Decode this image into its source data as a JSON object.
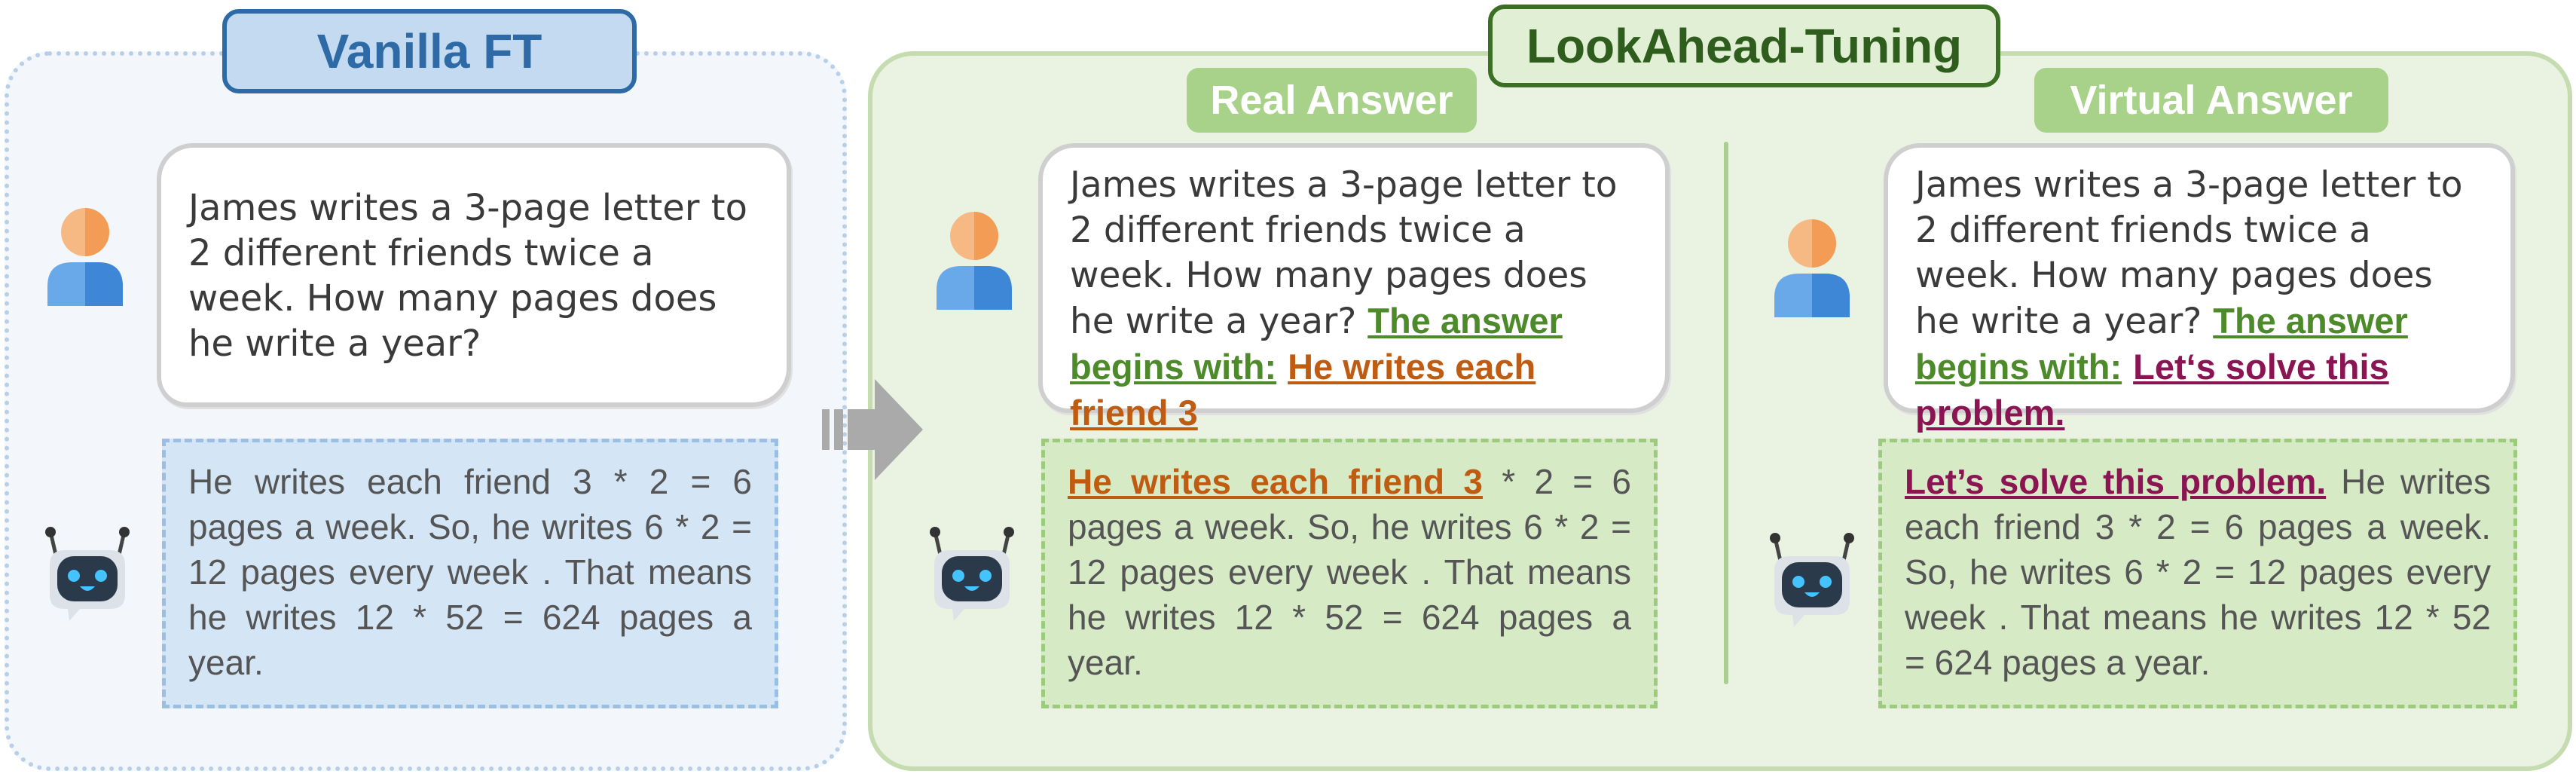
{
  "vanilla": {
    "title": "Vanilla FT",
    "question": "James writes a 3-page letter to 2 different friends twice a week. How many pages does he write a year?",
    "answer": "He writes each friend 3 * 2 = 6 pages a week. So, he writes 6 * 2 = 12 pages every week . That means he writes 12 * 52 = 624 pages a year."
  },
  "lookahead": {
    "title": "LookAhead-Tuning",
    "real": {
      "label": "Real Answer",
      "question": "James writes a 3-page letter to 2 different friends twice a week. How many pages does he write a year?",
      "prefix_intro": "The answer begins with:",
      "prefix": "He writes each friend 3",
      "answer_rest": "* 2 = 6 pages a week. So, he writes 6 * 2 = 12 pages every week . That means he writes 12 * 52 = 624 pages a year."
    },
    "virtual": {
      "label": "Virtual Answer",
      "question": "James writes a 3-page letter to 2 different friends twice a week. How many pages does he write a year?",
      "prefix_intro": "The answer begins with:",
      "prefix": "Let‘s solve this problem.",
      "answer_prefix": "Let’s solve this problem.",
      "answer_rest": "He writes each friend 3 * 2 = 6 pages a week. So, he writes 6 * 2 = 12 pages every week . That means he writes 12 * 52 = 624 pages a year."
    }
  },
  "icons": {
    "user": "user-icon",
    "bot": "robot-icon",
    "arrow": "right-arrow-icon"
  },
  "colors": {
    "vanilla_accent": "#2e6aa6",
    "lookahead_accent": "#3a6f24",
    "prefix_intro": "#4c8a2a",
    "real_prefix": "#c05c12",
    "virtual_prefix": "#8b1452"
  }
}
